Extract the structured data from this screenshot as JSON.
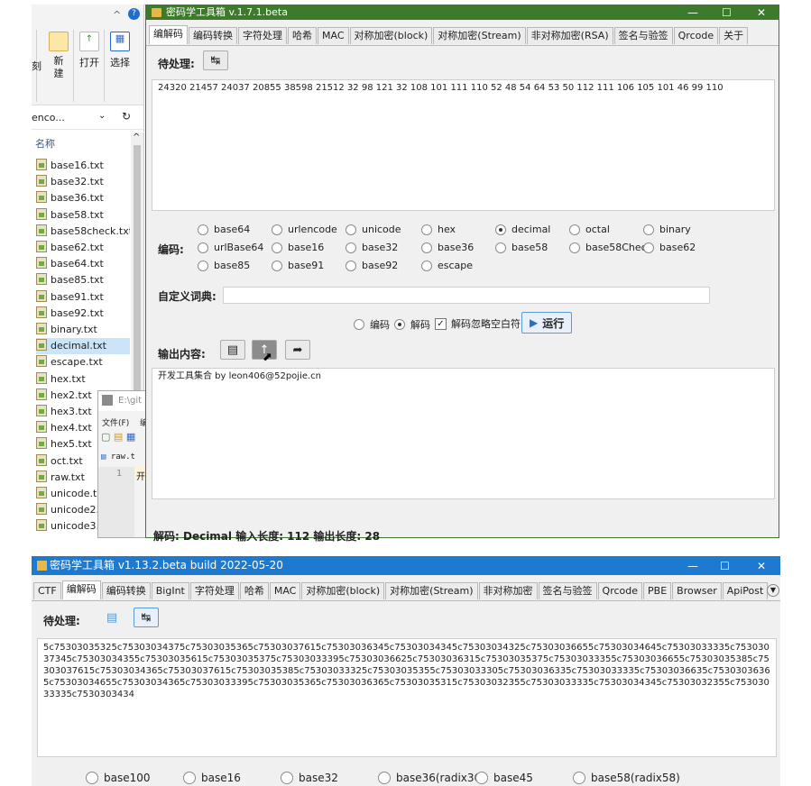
{
  "explorer": {
    "ribbon_left_label": "刻",
    "ribbon_new": "新\n建",
    "ribbon_open": "打开",
    "ribbon_select": "选择",
    "path": "enco...",
    "column_name": "名称",
    "files": [
      "base16.txt",
      "base32.txt",
      "base36.txt",
      "base58.txt",
      "base58check.txt",
      "base62.txt",
      "base64.txt",
      "base85.txt",
      "base91.txt",
      "base92.txt",
      "binary.txt",
      "decimal.txt",
      "escape.txt",
      "hex.txt",
      "hex2.txt",
      "hex3.txt",
      "hex4.txt",
      "hex5.txt",
      "oct.txt",
      "raw.txt",
      "unicode.tx",
      "unicode2.t",
      "unicode3.t"
    ],
    "selected_file": "decimal.txt"
  },
  "editor": {
    "title": "E:\\git",
    "menu": "文件(F)",
    "menu2": "编",
    "tab": "raw.t",
    "line_no": "1",
    "line_text": "开"
  },
  "app1": {
    "title": "密码学工具箱 v.1.7.1.beta",
    "tabs": [
      "编解码",
      "编码转换",
      "字符处理",
      "哈希",
      "MAC",
      "对称加密(block)",
      "对称加密(Stream)",
      "非对称加密(RSA)",
      "签名与验签",
      "Qrcode",
      "关于"
    ],
    "input_label": "待处理:",
    "input_text": "24320 21457 24037 20855 38598 21512 32 98 121 32 108 101 111 110 52 48 54 64 53 50 112 111 106 105 101 46 99 110",
    "encoding_label": "编码:",
    "encodings": [
      "base64",
      "urlencode",
      "unicode",
      "hex",
      "decimal",
      "octal",
      "binary",
      "urlBase64",
      "base16",
      "base32",
      "base36",
      "base58",
      "base58Check",
      "base62",
      "base85",
      "base91",
      "base92",
      "escape"
    ],
    "selected_encoding": "decimal",
    "dict_label": "自定义词典:",
    "dict_value": "",
    "mode_encode": "编码",
    "mode_decode": "解码",
    "selected_mode": "解码",
    "ignore_ws_label": "解码忽略空白符",
    "ignore_ws_checked": true,
    "run_label": "运行",
    "output_label": "输出内容:",
    "output_text": "开发工具集合 by leon406@52pojie.cn",
    "status": "解码: Decimal  输入长度: 112  输出长度: 28"
  },
  "app2": {
    "title": "密码学工具箱 v1.13.2.beta build 2022-05-20",
    "tabs": [
      "CTF",
      "编解码",
      "编码转换",
      "BigInt",
      "字符处理",
      "哈希",
      "MAC",
      "对称加密(block)",
      "对称加密(Stream)",
      "非对称加密",
      "签名与验签",
      "Qrcode",
      "PBE",
      "Browser",
      "ApiPost"
    ],
    "active_tab": "编解码",
    "input_label": "待处理:",
    "input_text": "5c75303035325c75303034375c75303035365c75303037615c75303036345c75303034345c75303034325c75303036655c75303034645c75303033335c75303037345c75303034355c75303035615c75303035375c75303033395c75303036625c75303036315c75303035375c75303033355c75303036655c75303035385c75303037615c75303034365c75303037615c75303035385c75303033325c75303035355c75303033305c75303036335c75303033335c75303036635c75303036365c75303034655c75303034365c75303033395c75303035365c75303036365c75303035315c75303032355c75303033335c75303034345c75303032355c75303033335c7530303434",
    "encodings": [
      "base100",
      "base16",
      "base32",
      "base36(radix36)",
      "base45",
      "base58(radix58)"
    ]
  }
}
